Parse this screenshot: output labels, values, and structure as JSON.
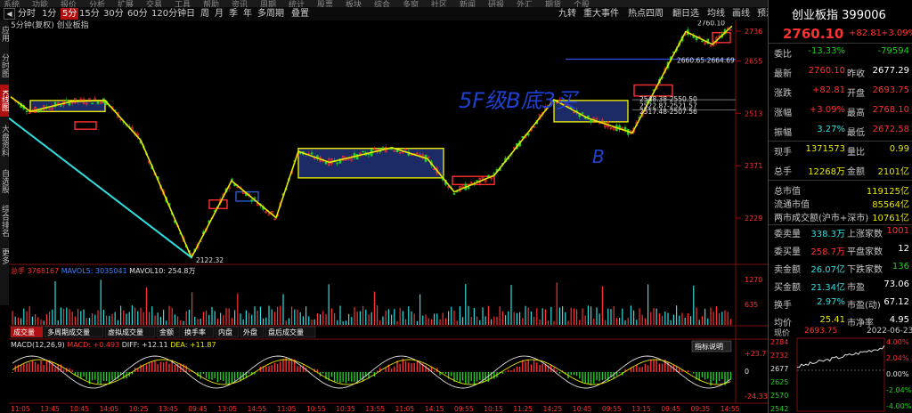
{
  "top_menu": [
    "系统",
    "功能",
    "报价",
    "分析",
    "扩展",
    "交易",
    "工具",
    "帮助",
    "资讯",
    "周期",
    "统计",
    "股票",
    "板块",
    "综合",
    "多窗",
    "社区",
    "新闻",
    "研报",
    "外汇",
    "期货",
    "个股"
  ],
  "toolbar": {
    "periods": [
      {
        "label": "分时",
        "active": false
      },
      {
        "label": "1分",
        "active": false
      },
      {
        "label": "5分",
        "active": true
      },
      {
        "label": "15分",
        "active": false
      },
      {
        "label": "30分",
        "active": false
      },
      {
        "label": "60分",
        "active": false
      },
      {
        "label": "120分钟",
        "active": false
      },
      {
        "label": "日",
        "active": false
      },
      {
        "label": "周",
        "active": false
      },
      {
        "label": "月",
        "active": false
      },
      {
        "label": "季",
        "active": false
      },
      {
        "label": "年",
        "active": false
      },
      {
        "label": "多周期",
        "active": false
      },
      {
        "label": "叠置",
        "active": false
      }
    ],
    "right_tools": [
      "九转",
      "重大事件",
      "热点四周",
      "翻日选",
      "均线",
      "画线",
      "预测"
    ],
    "square_buttons": [
      "◀",
      "▶",
      "✕"
    ]
  },
  "sidebar": [
    {
      "label": "应用",
      "active": false
    },
    {
      "label": "分时图",
      "active": false
    },
    {
      "label": "K线图",
      "active": true
    },
    {
      "label": "大盘资料",
      "active": false
    },
    {
      "label": "自选股",
      "active": false
    },
    {
      "label": "综合排名",
      "active": false
    },
    {
      "label": "更多",
      "active": false
    }
  ],
  "chart": {
    "subtitle": "5分钟(复权) 创业板指",
    "title_annotation": "5F级B底3买",
    "b_annotation": "B",
    "price_axis": [
      "2736",
      "2655",
      "2513",
      "2371",
      "2229"
    ],
    "price_labels": [
      "2760.10",
      "2660.65-2664.69",
      "2548.38-2550.50",
      "2522.87-2521.57",
      "2517.48-2507.56",
      "2122.32"
    ],
    "volume_header": {
      "label": "总手",
      "value": "3768167",
      "vol5_label": "MAVOL5:",
      "vol5": "3035041",
      "vol10_label": "MAVOL10:",
      "vol10": "254.8万"
    },
    "volume_axis": [
      "1270",
      "635"
    ],
    "tabs": [
      "成交量",
      "多周期成交量",
      "虚拟成交量",
      "金额",
      "换手率",
      "内盘",
      "外盘",
      "盘后成交量"
    ],
    "macd_header": {
      "name": "MACD(12,26,9)",
      "macd_label": "MACD:",
      "macd": "+0.493",
      "diff_label": "DIFF:",
      "diff": "+12.11",
      "dea_label": "DEA:",
      "dea": "+11.87"
    },
    "macd_axis": [
      "+23.77",
      "0",
      "-24.33"
    ],
    "indicator_button": "指标说明",
    "time_axis": [
      "11:05",
      "13:45",
      "10:45",
      "14:05",
      "10:25",
      "13:45",
      "09:45",
      "13:05",
      "14:55",
      "11:05",
      "10:55",
      "10:35",
      "13:55",
      "11:05",
      "14:15",
      "09:55",
      "10:15",
      "11:25",
      "14:25",
      "10:45",
      "09:55",
      "13:15",
      "09:45",
      "09:35",
      "14:55"
    ]
  },
  "quote": {
    "name": "创业板指",
    "code": "399006",
    "price": "2760.10",
    "change": "+82.81",
    "change_pct": "+3.09%",
    "rows1": [
      {
        "l1": "委比",
        "v1": "-13.33%",
        "c1": "green",
        "l2": "",
        "v2": "-79594",
        "c2": "green"
      },
      {
        "l1": "最新",
        "v1": "2760.10",
        "c1": "red",
        "l2": "昨收",
        "v2": "2677.29",
        "c2": "wht"
      },
      {
        "l1": "涨跌",
        "v1": "+82.81",
        "c1": "red",
        "l2": "开盘",
        "v2": "2693.75",
        "c2": "red"
      },
      {
        "l1": "涨幅",
        "v1": "+3.09%",
        "c1": "red",
        "l2": "最高",
        "v2": "2768.10",
        "c2": "red"
      },
      {
        "l1": "振幅",
        "v1": "3.27%",
        "c1": "cyan",
        "l2": "最低",
        "v2": "2672.58",
        "c2": "red"
      }
    ],
    "rows2": [
      {
        "l1": "现手",
        "v1": "1371573",
        "c1": "yel",
        "l2": "量比",
        "v2": "0.99",
        "c2": "yel"
      },
      {
        "l1": "总手",
        "v1": "12268万",
        "c1": "yel",
        "l2": "金额",
        "v2": "2101亿",
        "c2": "yel"
      }
    ],
    "rows3": [
      {
        "l1": "总市值",
        "v1": "119125亿",
        "c1": "yel"
      },
      {
        "l1": "流通市值",
        "v1": "85564亿",
        "c1": "yel"
      },
      {
        "l1": "两市成交额(沪市+深市)",
        "v1": "10761亿",
        "c1": "yel"
      }
    ],
    "rows4": [
      {
        "l1": "委卖量",
        "v1": "338.3万",
        "c1": "cyan",
        "l2": "上涨家数",
        "v2": "1001",
        "c2": "red"
      },
      {
        "l1": "委买量",
        "v1": "258.7万",
        "c1": "red",
        "l2": "平盘家数",
        "v2": "12",
        "c2": "wht"
      },
      {
        "l1": "卖金额",
        "v1": "26.07亿",
        "c1": "cyan",
        "l2": "下跌家数",
        "v2": "136",
        "c2": "green"
      },
      {
        "l1": "买金额",
        "v1": "21.34亿",
        "c1": "cyan",
        "l2": "市盈",
        "v2": "73.06",
        "c2": "wht"
      },
      {
        "l1": "换手",
        "v1": "2.97%",
        "c1": "cyan",
        "l2": "市盈(动)",
        "v2": "67.12",
        "c2": "wht"
      },
      {
        "l1": "均价",
        "v1": "25.41",
        "c1": "yel",
        "l2": "市净率",
        "v2": "4.95",
        "c2": "wht"
      }
    ],
    "mini": {
      "label": "现价",
      "price": "2693.75",
      "date": "2022-06-23",
      "axis_left": [
        "2784",
        "2732",
        "2677",
        "2625",
        "2570",
        "2542"
      ],
      "axis_right": [
        "4.00%",
        "2.04%",
        "0.00%",
        "-2.04%",
        "-4.00%"
      ]
    }
  },
  "colors": {
    "up": "#ff3030",
    "down": "#20d020",
    "zs": "#e8e800",
    "cyan": "#30e0e0",
    "accent": "#b01010"
  }
}
